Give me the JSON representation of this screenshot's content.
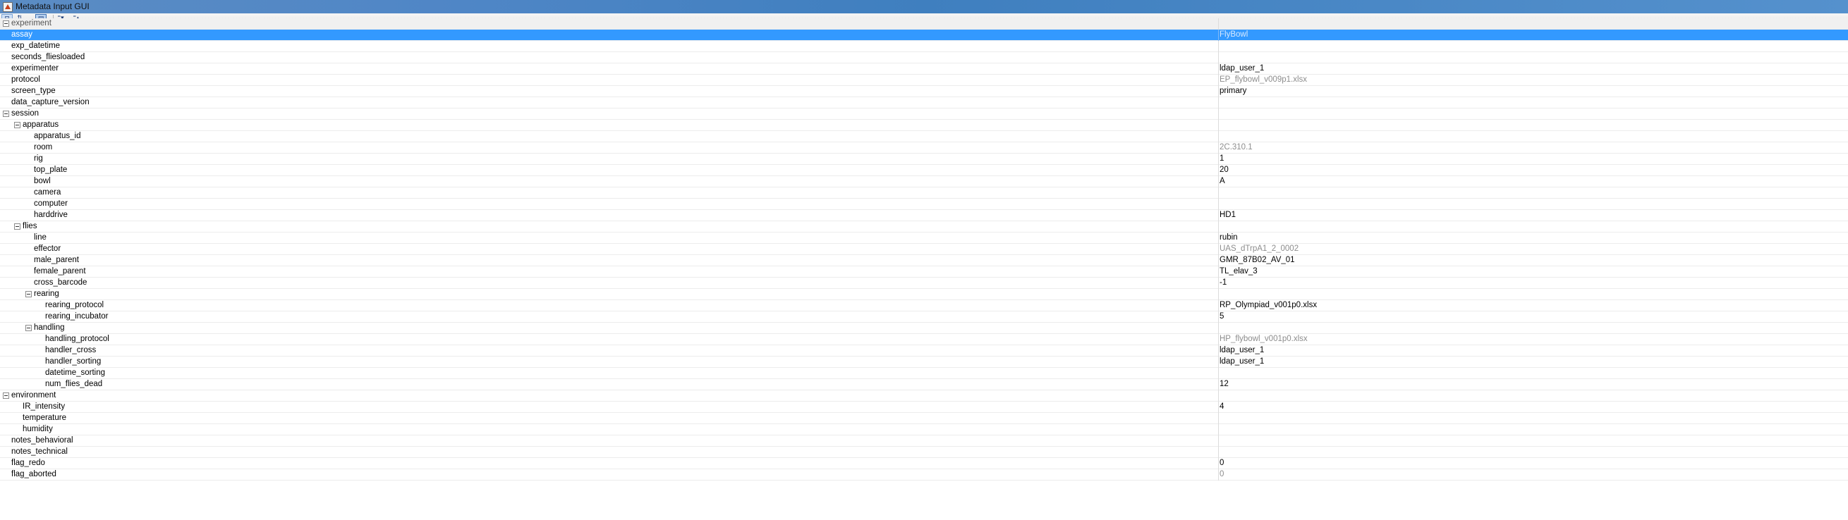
{
  "window": {
    "title": "Metadata Input GUI"
  },
  "toolbar": {
    "buttons": [
      {
        "name": "categorized-view-icon",
        "glyph": "⊟"
      },
      {
        "name": "sort-alphabetical-icon",
        "glyph": "⇅"
      },
      {
        "name": "show-description-icon",
        "glyph": "▤"
      },
      {
        "name": "expand-all-icon",
        "glyph": "⁼▾"
      },
      {
        "name": "collapse-all-icon",
        "glyph": "⁼▴"
      }
    ]
  },
  "tree": {
    "rows": [
      {
        "key": "experiment",
        "value": "",
        "level": 0,
        "toggle": true,
        "group_top": true
      },
      {
        "key": "assay",
        "value": "FlyBowl",
        "level": 0,
        "selected": true,
        "readonly": true
      },
      {
        "key": "exp_datetime",
        "value": "",
        "level": 0
      },
      {
        "key": "seconds_fliesloaded",
        "value": "",
        "level": 0
      },
      {
        "key": "experimenter",
        "value": "ldap_user_1",
        "level": 0
      },
      {
        "key": "protocol",
        "value": "EP_flybowl_v009p1.xlsx",
        "level": 0,
        "readonly": true
      },
      {
        "key": "screen_type",
        "value": "primary",
        "level": 0
      },
      {
        "key": "data_capture_version",
        "value": "",
        "level": 0
      },
      {
        "key": "session",
        "value": "",
        "level": 0,
        "toggle": true
      },
      {
        "key": "apparatus",
        "value": "",
        "level": 1,
        "toggle": true
      },
      {
        "key": "apparatus_id",
        "value": "",
        "level": 2
      },
      {
        "key": "room",
        "value": "2C.310.1",
        "level": 2,
        "readonly": true
      },
      {
        "key": "rig",
        "value": "1",
        "level": 2
      },
      {
        "key": "top_plate",
        "value": "20",
        "level": 2
      },
      {
        "key": "bowl",
        "value": "A",
        "level": 2
      },
      {
        "key": "camera",
        "value": "",
        "level": 2
      },
      {
        "key": "computer",
        "value": "",
        "level": 2
      },
      {
        "key": "harddrive",
        "value": "HD1",
        "level": 2
      },
      {
        "key": "flies",
        "value": "",
        "level": 1,
        "toggle": true
      },
      {
        "key": "line",
        "value": "rubin",
        "level": 2
      },
      {
        "key": "effector",
        "value": "UAS_dTrpA1_2_0002",
        "level": 2,
        "readonly": true
      },
      {
        "key": "male_parent",
        "value": "GMR_87B02_AV_01",
        "level": 2
      },
      {
        "key": "female_parent",
        "value": "TL_elav_3",
        "level": 2
      },
      {
        "key": "cross_barcode",
        "value": "-1",
        "level": 2
      },
      {
        "key": "rearing",
        "value": "",
        "level": 2,
        "toggle": true
      },
      {
        "key": "rearing_protocol",
        "value": "RP_Olympiad_v001p0.xlsx",
        "level": 3
      },
      {
        "key": "rearing_incubator",
        "value": "5",
        "level": 3
      },
      {
        "key": "handling",
        "value": "",
        "level": 2,
        "toggle": true
      },
      {
        "key": "handling_protocol",
        "value": "HP_flybowl_v001p0.xlsx",
        "level": 3,
        "readonly": true
      },
      {
        "key": "handler_cross",
        "value": "ldap_user_1",
        "level": 3
      },
      {
        "key": "handler_sorting",
        "value": "ldap_user_1",
        "level": 3
      },
      {
        "key": "datetime_sorting",
        "value": "",
        "level": 3
      },
      {
        "key": "num_flies_dead",
        "value": "12",
        "level": 3
      },
      {
        "key": "environment",
        "value": "",
        "level": 0,
        "toggle": true
      },
      {
        "key": "IR_intensity",
        "value": "4",
        "level": 1
      },
      {
        "key": "temperature",
        "value": "",
        "level": 1
      },
      {
        "key": "humidity",
        "value": "",
        "level": 1
      },
      {
        "key": "notes_behavioral",
        "value": "",
        "level": 0
      },
      {
        "key": "notes_technical",
        "value": "",
        "level": 0
      },
      {
        "key": "flag_redo",
        "value": "0",
        "level": 0
      },
      {
        "key": "flag_aborted",
        "value": "0",
        "level": 0,
        "readonly": true
      }
    ]
  },
  "colors": {
    "selection": "#3399ff",
    "title_bar": "#4f86c6",
    "readonly_text": "#8d8d8d"
  }
}
